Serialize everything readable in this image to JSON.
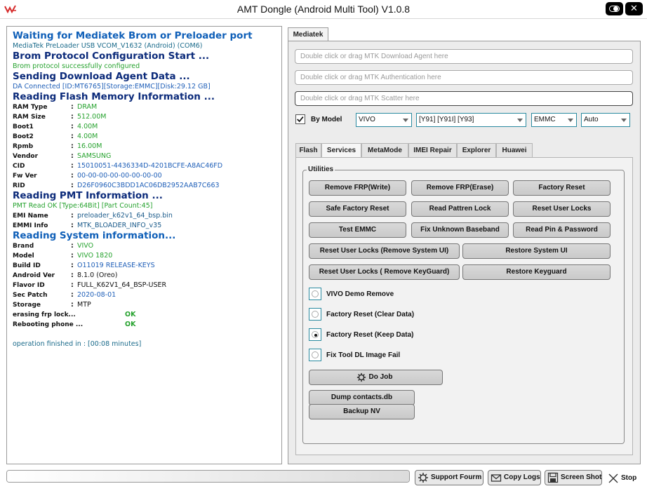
{
  "window": {
    "title": "AMT Dongle (Android Multi Tool) V1.0.8"
  },
  "log": {
    "l1": "Waiting for Mediatek Brom or Preloader port",
    "l2": "MediaTek PreLoader USB VCOM_V1632 (Android) (COM6)",
    "l3": "Brom Protocol Configuration Start ...",
    "l4": "Brom protocol successfully configured",
    "l5": "Sending Download Agent Data ...",
    "l6": "DA Connected [ID:MT6765][Storage:EMMC][Disk:29.12 GB]",
    "l7": "Reading Flash Memory Information ...",
    "flash": [
      {
        "k": "RAM Type",
        "v": "DRAM"
      },
      {
        "k": "RAM Size",
        "v": "512.00M"
      },
      {
        "k": "Boot1",
        "v": "4.00M"
      },
      {
        "k": "Boot2",
        "v": "4.00M"
      },
      {
        "k": "Rpmb",
        "v": "16.00M"
      },
      {
        "k": "Vendor",
        "v": "SAMSUNG"
      },
      {
        "k": "CID",
        "v": "15010051-4436334D-4201BCFE-A8AC46FD"
      },
      {
        "k": "Fw Ver",
        "v": "00-00-00-00-00-00-00-00"
      },
      {
        "k": "RID",
        "v": "D26F0960C3BDD1AC06DB2952AAB7C663"
      }
    ],
    "l8": "Reading PMT Information ...",
    "l9": "PMT Read OK [Type:64Bit] [Part Count:45]",
    "pmt": [
      {
        "k": "EMI Name",
        "v": "preloader_k62v1_64_bsp.bin"
      },
      {
        "k": "EMMI Info",
        "v": "MTK_BLOADER_INFO_v35"
      }
    ],
    "l10": "Reading System information...",
    "system": [
      {
        "k": "Brand",
        "v": "VIVO"
      },
      {
        "k": "Model",
        "v": "VIVO 1820"
      },
      {
        "k": "Build ID",
        "v": "O11019 RELEASE-KEYS"
      },
      {
        "k": "Android Ver",
        "v": "8.1.0 (Oreo)"
      },
      {
        "k": "Flavor ID",
        "v": "FULL_K62V1_64_BSP-USER"
      },
      {
        "k": "Sec Patch",
        "v": "2020-08-01"
      },
      {
        "k": "Storage",
        "v": "MTP"
      }
    ],
    "ops": [
      {
        "k": "erasing frp lock...",
        "v": "OK"
      },
      {
        "k": "Rebooting phone ...",
        "v": "OK"
      }
    ],
    "finished": "operation finished in : [00:08 minutes]",
    "sep": ":"
  },
  "mediatek": {
    "tab": "Mediatek",
    "da_placeholder": "Double click or drag MTK Download Agent here",
    "auth_placeholder": "Double click or drag MTK Authentication here",
    "scatter_placeholder": "Double click or drag MTK Scatter here",
    "by_model_label": "By Model",
    "by_model_checked": true,
    "brand_select": "VIVO",
    "model_select": "[Y91] [Y91I] [Y93]",
    "storage_select": "EMMC",
    "mode_select": "Auto"
  },
  "subtabs": [
    "Flash",
    "Services",
    "MetaMode",
    "IMEI Repair",
    "Explorer",
    "Huawei"
  ],
  "services": {
    "group_label": "Utilities",
    "buttons": {
      "remove_frp_write": "Remove FRP(Write)",
      "remove_frp_erase": "Remove FRP(Erase)",
      "factory_reset": "Factory Reset",
      "safe_factory_reset": "Safe Factory Reset",
      "read_pattern_lock": "Read Pattren Lock",
      "reset_user_locks": "Reset User Locks",
      "test_emmc": "Test EMMC",
      "fix_unknown_baseband": "Fix Unknown Baseband",
      "read_pin_password": "Read Pin & Password",
      "reset_user_locks_systemui": "Reset User Locks (Remove System UI)",
      "restore_system_ui": "Restore System UI",
      "reset_user_locks_keyguard": "Reset User Locks ( Remove KeyGuard)",
      "restore_keyguard": "Restore Keyguard",
      "do_job": "Do Job",
      "dump_contacts": "Dump contacts.db",
      "backup_nv": "Backup NV"
    },
    "options": {
      "vivo_demo": "VIVO Demo Remove",
      "factory_clear": "Factory Reset (Clear Data)",
      "factory_keep": "Factory Reset (Keep Data)",
      "fix_dl_image": "Fix Tool DL Image Fail"
    },
    "selected_option": "factory_keep"
  },
  "bottom": {
    "support": "Support Fourm",
    "copy_logs": "Copy Logs",
    "screenshot": "Screen Shot",
    "stop": "Stop"
  }
}
